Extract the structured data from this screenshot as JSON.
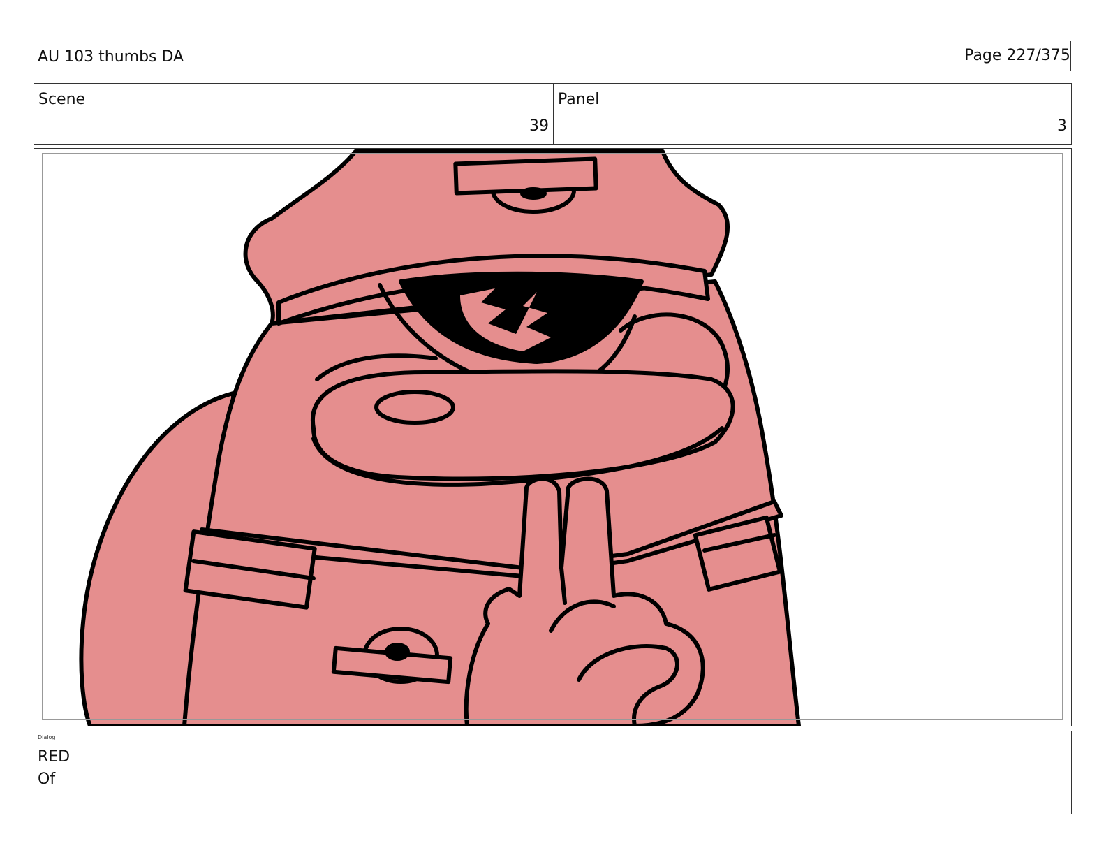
{
  "header": {
    "title": "AU 103 thumbs DA",
    "page_indicator": "Page 227/375"
  },
  "info": {
    "scene_label": "Scene",
    "scene_value": "39",
    "panel_label": "Panel",
    "panel_value": "3"
  },
  "dialog": {
    "label": "Dialog",
    "lines": [
      "RED",
      "Of"
    ]
  },
  "colors": {
    "character_fill": "#e58e8e",
    "line_art": "#000000",
    "frame_border": "#333333"
  }
}
